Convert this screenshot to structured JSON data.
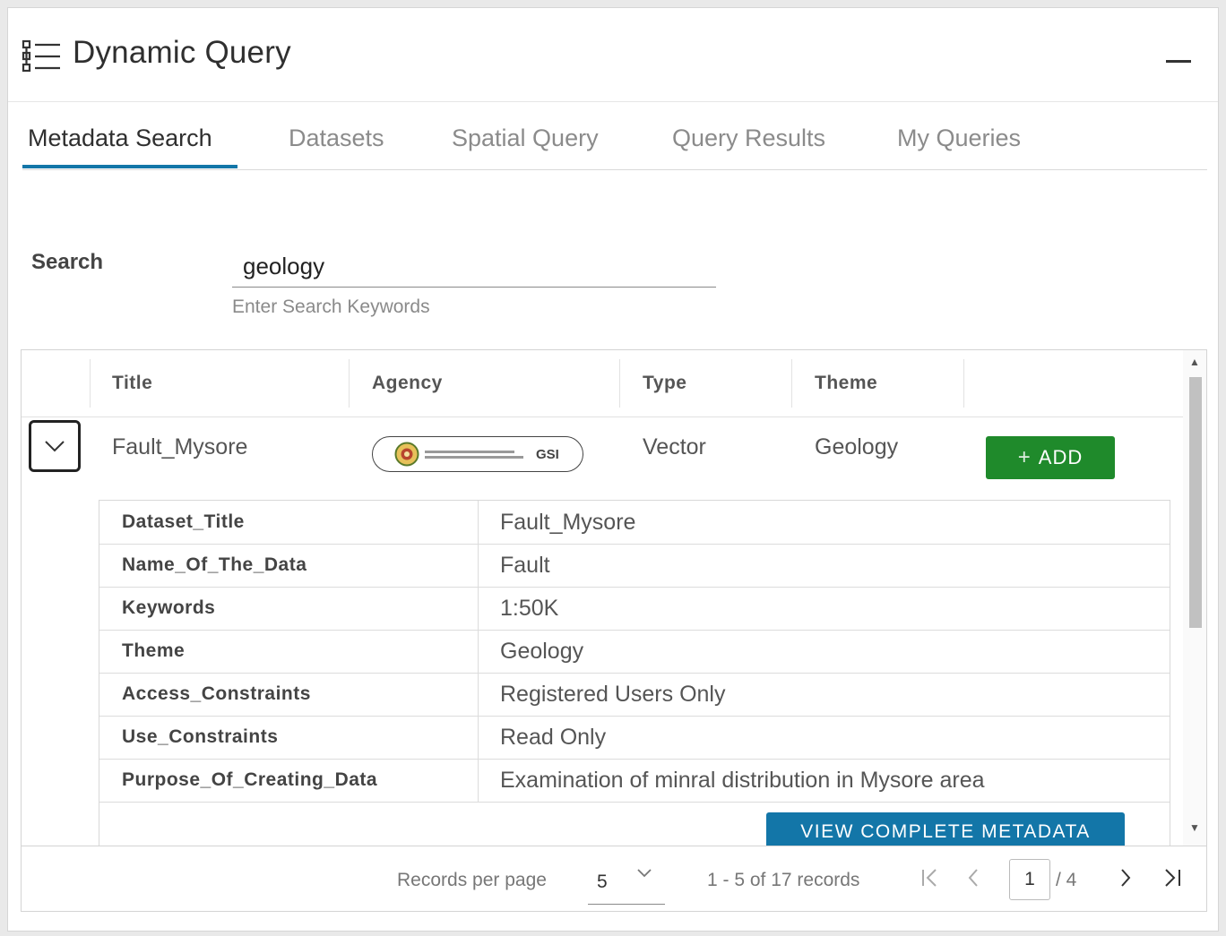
{
  "header": {
    "title": "Dynamic Query",
    "icon": "list-tree-icon"
  },
  "tabs": [
    {
      "label": "Metadata Search",
      "active": true
    },
    {
      "label": "Datasets",
      "active": false
    },
    {
      "label": "Spatial Query",
      "active": false
    },
    {
      "label": "Query Results",
      "active": false
    },
    {
      "label": "My Queries",
      "active": false
    }
  ],
  "search": {
    "label": "Search",
    "value": "geology",
    "hint": "Enter Search Keywords"
  },
  "grid": {
    "columns": [
      "Title",
      "Agency",
      "Type",
      "Theme"
    ],
    "rows": [
      {
        "title": "Fault_Mysore",
        "agency": "GSI",
        "type": "Vector",
        "theme": "Geology",
        "add_label": "ADD"
      }
    ],
    "details": [
      {
        "key": "Dataset_Title",
        "value": "Fault_Mysore"
      },
      {
        "key": "Name_Of_The_Data",
        "value": "Fault"
      },
      {
        "key": "Keywords",
        "value": "1:50K"
      },
      {
        "key": "Theme",
        "value": "Geology"
      },
      {
        "key": "Access_Constraints",
        "value": "Registered Users Only"
      },
      {
        "key": "Use_Constraints",
        "value": "Read Only"
      },
      {
        "key": "Purpose_Of_Creating_Data",
        "value": "Examination of minral distribution in Mysore area"
      }
    ],
    "view_metadata_label": "VIEW COMPLETE METADATA"
  },
  "pager": {
    "records_per_page_label": "Records per page",
    "records_per_page": "5",
    "summary": "1 - 5 of 17 records",
    "current_page": "1",
    "total_pages": "/ 4"
  },
  "colors": {
    "accent": "#1376a8",
    "add_green": "#1f8a2b"
  }
}
